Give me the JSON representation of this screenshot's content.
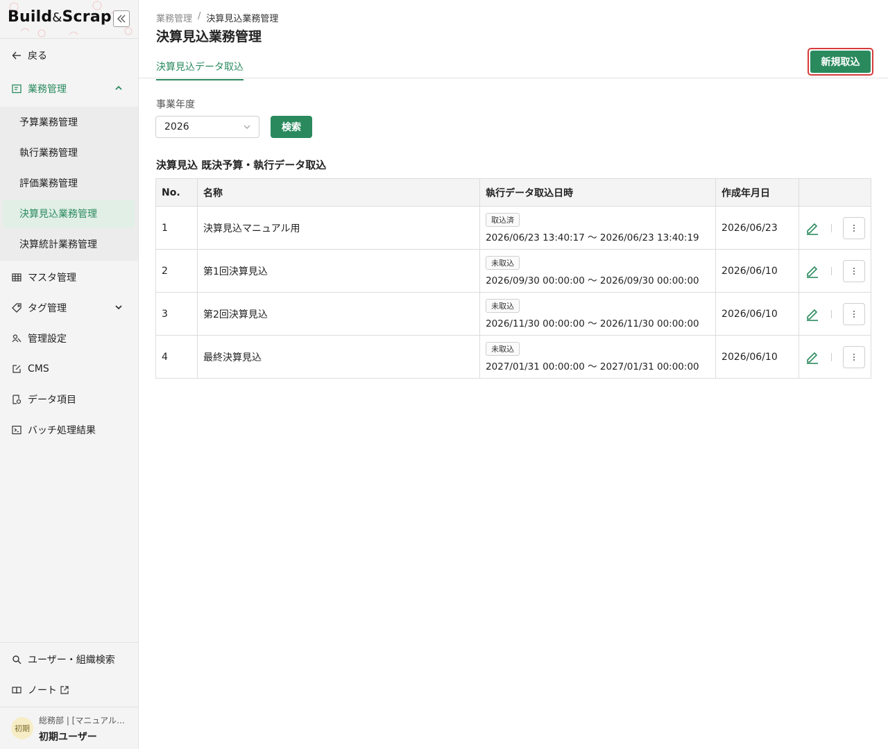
{
  "logo": {
    "part1": "Build",
    "amp": "&",
    "part2": "Scrap"
  },
  "sidebar": {
    "back_label": "戻る",
    "group_label": "業務管理",
    "sub_items": [
      "予算業務管理",
      "執行業務管理",
      "評価業務管理",
      "決算見込業務管理",
      "決算統計業務管理"
    ],
    "items": [
      "マスタ管理",
      "タグ管理",
      "管理設定",
      "CMS",
      "データ項目",
      "バッチ処理結果"
    ],
    "bottom_items": [
      "ユーザー・組織検索",
      "ノート"
    ],
    "user_avatar": "初期",
    "user_org": "総務部 | [マニュアル…",
    "user_name": "初期ユーザー"
  },
  "breadcrumb": {
    "parent": "業務管理",
    "separator": "/",
    "current": "決算見込業務管理"
  },
  "page_title": "決算見込業務管理",
  "tab_label": "決算見込データ取込",
  "new_button": "新規取込",
  "filter": {
    "label": "事業年度",
    "year_value": "2026",
    "search_button": "検索"
  },
  "section_title": "決算見込 既決予算・執行データ取込",
  "table": {
    "headers": [
      "No.",
      "名称",
      "執行データ取込日時",
      "作成年月日",
      ""
    ],
    "rows": [
      {
        "no": "1",
        "name": "決算見込マニュアル用",
        "status": "取込済",
        "period": "2026/06/23 13:40:17 〜 2026/06/23 13:40:19",
        "created": "2026/06/23"
      },
      {
        "no": "2",
        "name": "第1回決算見込",
        "status": "未取込",
        "period": "2026/09/30 00:00:00 〜 2026/09/30 00:00:00",
        "created": "2026/06/10"
      },
      {
        "no": "3",
        "name": "第2回決算見込",
        "status": "未取込",
        "period": "2026/11/30 00:00:00 〜 2026/11/30 00:00:00",
        "created": "2026/06/10"
      },
      {
        "no": "4",
        "name": "最終決算見込",
        "status": "未取込",
        "period": "2027/01/31 00:00:00 〜 2027/01/31 00:00:00",
        "created": "2026/06/10"
      }
    ]
  },
  "colors": {
    "accent": "#2a8a5e",
    "highlight": "#d63a3a"
  }
}
